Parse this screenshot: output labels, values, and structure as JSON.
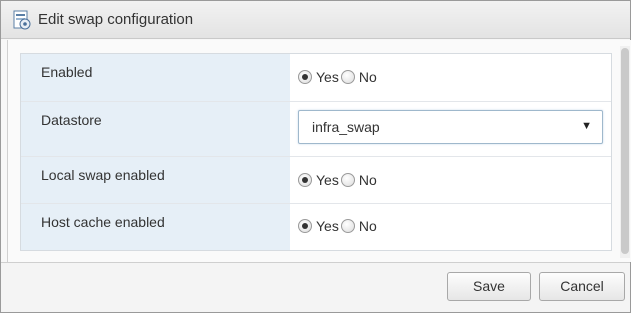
{
  "dialog": {
    "title": "Edit swap configuration",
    "icon": "swap-config-icon"
  },
  "form": {
    "rows": [
      {
        "label": "Enabled",
        "type": "radio",
        "selected": "Yes",
        "options": [
          "Yes",
          "No"
        ]
      },
      {
        "label": "Datastore",
        "type": "select",
        "value": "infra_swap"
      },
      {
        "label": "Local swap enabled",
        "type": "radio",
        "selected": "Yes",
        "options": [
          "Yes",
          "No"
        ]
      },
      {
        "label": "Host cache enabled",
        "type": "radio",
        "selected": "Yes",
        "options": [
          "Yes",
          "No"
        ]
      }
    ]
  },
  "footer": {
    "save_label": "Save",
    "cancel_label": "Cancel"
  },
  "colors": {
    "label_bg": "#e6eff7",
    "select_border": "#9fb8cc"
  }
}
